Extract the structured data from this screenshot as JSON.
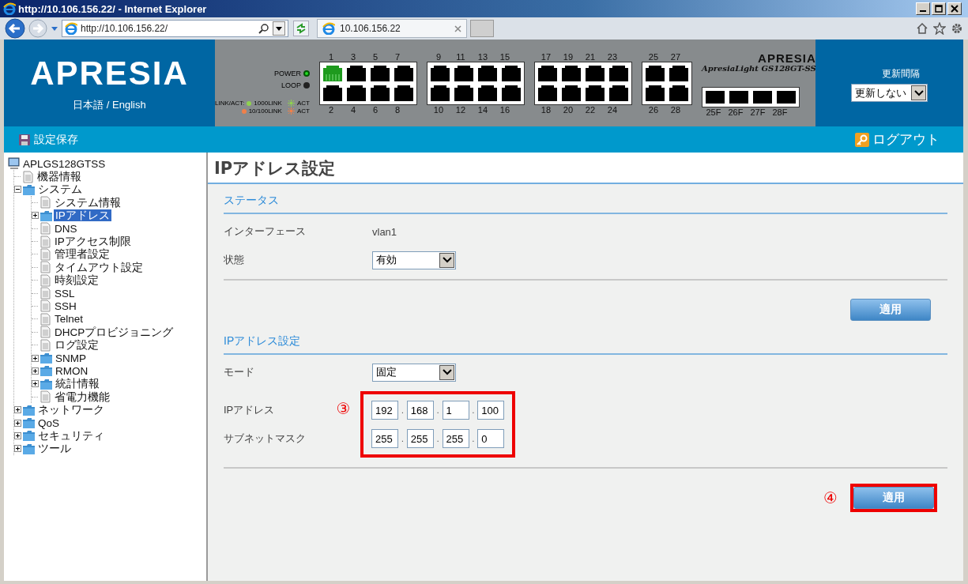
{
  "browser": {
    "title": "http://10.106.156.22/ - Internet Explorer",
    "address": "http://10.106.156.22/",
    "tab": {
      "label": "10.106.156.22"
    }
  },
  "header": {
    "logo": "APRESIA",
    "language": "日本語 / English",
    "switch": {
      "power": {
        "label": "POWER",
        "on": true
      },
      "loop": {
        "label": "LOOP",
        "on": false
      },
      "legend_title": "LINK/ACT:",
      "legend": [
        {
          "link": "1000LINK",
          "act": "ACT",
          "color": "#8fd14f"
        },
        {
          "link": "10/100LINK",
          "act": "ACT",
          "color": "#f0804a"
        }
      ],
      "brand": "APRESIA",
      "model": "ApresiaLight GS128GT-SS",
      "groups": [
        {
          "kind": "rj45",
          "ports": [
            {
              "label": "1",
              "link": true
            },
            {
              "label": "2",
              "link": false
            },
            {
              "label": "3",
              "link": false
            },
            {
              "label": "4",
              "link": false
            },
            {
              "label": "5",
              "link": false
            },
            {
              "label": "6",
              "link": false
            },
            {
              "label": "7",
              "link": false
            },
            {
              "label": "8",
              "link": false
            }
          ]
        },
        {
          "kind": "rj45",
          "ports": [
            {
              "label": "9",
              "link": false
            },
            {
              "label": "10",
              "link": false
            },
            {
              "label": "11",
              "link": false
            },
            {
              "label": "12",
              "link": false
            },
            {
              "label": "13",
              "link": false
            },
            {
              "label": "14",
              "link": false
            },
            {
              "label": "15",
              "link": false
            },
            {
              "label": "16",
              "link": false
            }
          ]
        },
        {
          "kind": "rj45",
          "ports": [
            {
              "label": "17",
              "link": false
            },
            {
              "label": "18",
              "link": false
            },
            {
              "label": "19",
              "link": false
            },
            {
              "label": "20",
              "link": false
            },
            {
              "label": "21",
              "link": false
            },
            {
              "label": "22",
              "link": false
            },
            {
              "label": "23",
              "link": false
            },
            {
              "label": "24",
              "link": false
            }
          ]
        },
        {
          "kind": "rj45",
          "ports": [
            {
              "label": "25",
              "link": false
            },
            {
              "label": "26",
              "link": false
            },
            {
              "label": "27",
              "link": false
            },
            {
              "label": "28",
              "link": false
            }
          ]
        },
        {
          "kind": "sfp",
          "ports": [
            {
              "label": "25F"
            },
            {
              "label": "26F"
            },
            {
              "label": "27F"
            },
            {
              "label": "28F"
            }
          ]
        }
      ]
    },
    "refresh": {
      "label": "更新間隔",
      "value": "更新しない"
    }
  },
  "toolbar": {
    "save": "設定保存",
    "logout": "ログアウト"
  },
  "tree": {
    "label": "APLGS128GTSS",
    "kind": "computer",
    "selected": false,
    "children": [
      {
        "label": "機器情報",
        "kind": "page",
        "selected": false
      },
      {
        "label": "システム",
        "kind": "folder",
        "expanded": true,
        "selected": false,
        "children": [
          {
            "label": "システム情報",
            "kind": "page",
            "selected": false
          },
          {
            "label": "IPアドレス",
            "kind": "folder",
            "expanded": false,
            "selected": true
          },
          {
            "label": "DNS",
            "kind": "page",
            "selected": false
          },
          {
            "label": "IPアクセス制限",
            "kind": "page",
            "selected": false
          },
          {
            "label": "管理者設定",
            "kind": "page",
            "selected": false
          },
          {
            "label": "タイムアウト設定",
            "kind": "page",
            "selected": false
          },
          {
            "label": "時刻設定",
            "kind": "page",
            "selected": false
          },
          {
            "label": "SSL",
            "kind": "page",
            "selected": false
          },
          {
            "label": "SSH",
            "kind": "page",
            "selected": false
          },
          {
            "label": "Telnet",
            "kind": "page",
            "selected": false
          },
          {
            "label": "DHCPプロビジョニング",
            "kind": "page",
            "selected": false
          },
          {
            "label": "ログ設定",
            "kind": "page",
            "selected": false
          },
          {
            "label": "SNMP",
            "kind": "folder",
            "expanded": false,
            "selected": false
          },
          {
            "label": "RMON",
            "kind": "folder",
            "expanded": false,
            "selected": false
          },
          {
            "label": "統計情報",
            "kind": "folder",
            "expanded": false,
            "selected": false
          },
          {
            "label": "省電力機能",
            "kind": "page",
            "selected": false
          }
        ]
      },
      {
        "label": "ネットワーク",
        "kind": "folder",
        "expanded": false,
        "selected": false
      },
      {
        "label": "QoS",
        "kind": "folder",
        "expanded": false,
        "selected": false
      },
      {
        "label": "セキュリティ",
        "kind": "folder",
        "expanded": false,
        "selected": false
      },
      {
        "label": "ツール",
        "kind": "folder",
        "expanded": false,
        "selected": false
      }
    ]
  },
  "page": {
    "title": "IPアドレス設定",
    "sections": [
      {
        "heading": "ステータス",
        "rows": [
          {
            "kind": "text",
            "label": "インターフェース",
            "value": "vlan1"
          },
          {
            "kind": "select",
            "label": "状態",
            "value": "有効"
          }
        ],
        "button": {
          "label": "適用",
          "highlighted": false
        }
      },
      {
        "heading": "IPアドレス設定",
        "rows": [
          {
            "kind": "select",
            "label": "モード",
            "value": "固定"
          }
        ],
        "framed": {
          "marker": "③",
          "rows": [
            {
              "kind": "octets",
              "label": "IPアドレス",
              "octets": [
                "192",
                "168",
                "1",
                "100"
              ],
              "separators": [
                ".",
                ".",
                "."
              ]
            },
            {
              "kind": "octets",
              "label": "サブネットマスク",
              "octets": [
                "255",
                "255",
                "255",
                "0"
              ],
              "separators": [
                ".",
                ".",
                "."
              ]
            }
          ]
        },
        "button": {
          "label": "適用",
          "highlighted": true,
          "marker": "④"
        }
      }
    ]
  }
}
